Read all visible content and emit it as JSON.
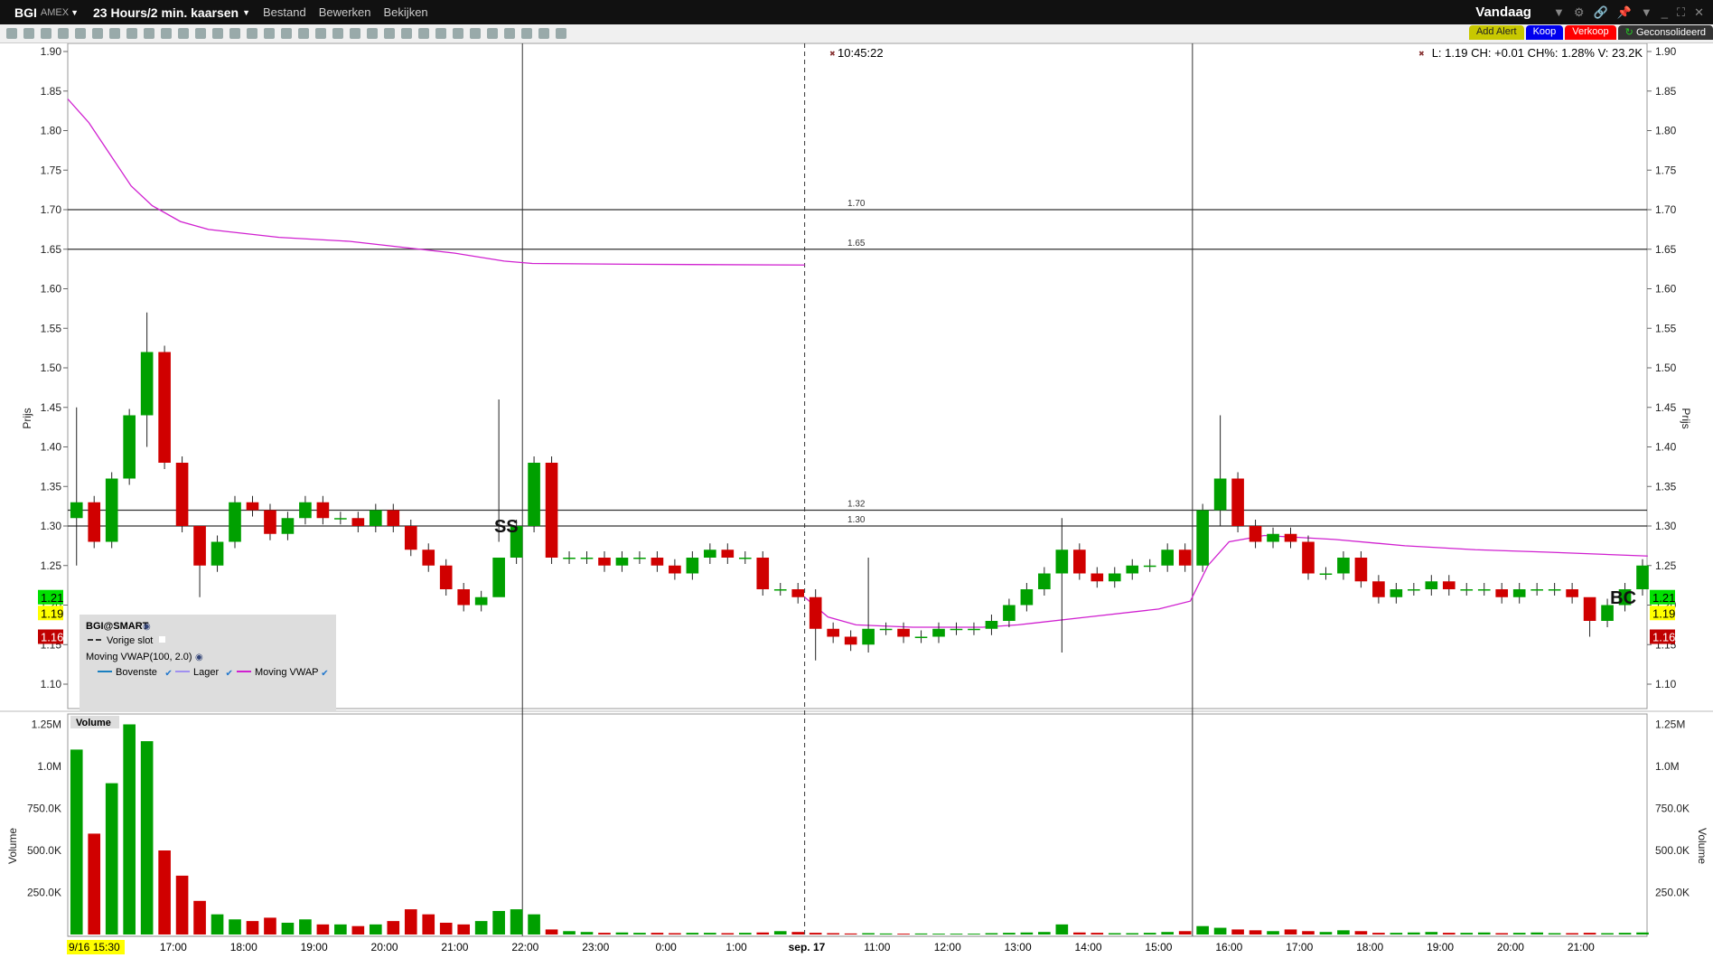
{
  "window": {
    "symbol": "BGI",
    "exchange": "AMEX",
    "period": "23 Hours/2 min. kaarsen",
    "menus": [
      "Bestand",
      "Bewerken",
      "Bekijken"
    ],
    "range": "Vandaag"
  },
  "buttons": {
    "add_alert": "Add Alert",
    "buy": "Koop",
    "sell": "Verkoop",
    "consolidated": "Geconsolideerd"
  },
  "status": "L: 1.19 CH: +0.01 CH%: 1.28% V: 23.2K",
  "crosshair_time": "10:45:22",
  "legend": {
    "title": "BGI@SMART",
    "prev_close": "Vorige slot",
    "indicator": "Moving VWAP(100, 2.0)",
    "items": [
      "Bovenste",
      "Lager",
      "Moving VWAP"
    ]
  },
  "colors": {
    "up": "#00a000",
    "down": "#d00000",
    "vwap": "#d020d0",
    "upper": "#1a7fc0",
    "lower": "#a090f0"
  },
  "chart_data": {
    "type": "candlestick",
    "price_axis": {
      "label": "Prijs",
      "ylim": [
        1.1,
        1.9
      ],
      "ticks": [
        "1.90",
        "1.85",
        "1.80",
        "1.75",
        "1.70",
        "1.65",
        "1.60",
        "1.55",
        "1.50",
        "1.45",
        "1.40",
        "1.35",
        "1.30",
        "1.25",
        "1.20",
        "1.15",
        "1.10"
      ]
    },
    "volume_axis": {
      "label": "Volume",
      "title": "Volume",
      "ylim_k": [
        0,
        1300
      ],
      "ticks": [
        "1.25M",
        "1.0M",
        "750.0K",
        "500.0K",
        "250.0K"
      ]
    },
    "x_axis": {
      "unit": "session hours from 9/16 15:30",
      "xlim": [
        0,
        22.45
      ],
      "ticks": [
        {
          "x": 0,
          "label": "9/16 15:30"
        },
        {
          "x": 1.5,
          "label": "17:00"
        },
        {
          "x": 2.5,
          "label": "18:00"
        },
        {
          "x": 3.5,
          "label": "19:00"
        },
        {
          "x": 4.5,
          "label": "20:00"
        },
        {
          "x": 5.5,
          "label": "21:00"
        },
        {
          "x": 6.5,
          "label": "22:00"
        },
        {
          "x": 7.5,
          "label": "23:00"
        },
        {
          "x": 8.5,
          "label": "0:00"
        },
        {
          "x": 9.5,
          "label": "1:00"
        },
        {
          "x": 10.5,
          "label": "sep. 17"
        },
        {
          "x": 11.5,
          "label": "11:00"
        },
        {
          "x": 12.5,
          "label": "12:00"
        },
        {
          "x": 13.5,
          "label": "13:00"
        },
        {
          "x": 14.5,
          "label": "14:00"
        },
        {
          "x": 15.5,
          "label": "15:00"
        },
        {
          "x": 16.5,
          "label": "16:00"
        },
        {
          "x": 17.5,
          "label": "17:00"
        },
        {
          "x": 18.5,
          "label": "18:00"
        },
        {
          "x": 19.5,
          "label": "19:00"
        },
        {
          "x": 20.5,
          "label": "20:00"
        },
        {
          "x": 21.5,
          "label": "21:00"
        }
      ]
    },
    "candle_step_hours": 0.25,
    "closes": [
      1.33,
      1.28,
      1.36,
      1.44,
      1.52,
      1.38,
      1.3,
      1.25,
      1.28,
      1.33,
      1.32,
      1.29,
      1.31,
      1.33,
      1.31,
      1.31,
      1.3,
      1.32,
      1.3,
      1.27,
      1.25,
      1.22,
      1.2,
      1.21,
      1.26,
      1.3,
      1.38,
      1.26,
      1.26,
      1.26,
      1.25,
      1.26,
      1.26,
      1.25,
      1.24,
      1.26,
      1.27,
      1.26,
      1.26,
      1.22,
      1.22,
      1.21,
      1.17,
      1.16,
      1.15,
      1.17,
      1.17,
      1.16,
      1.16,
      1.17,
      1.17,
      1.17,
      1.18,
      1.2,
      1.22,
      1.24,
      1.27,
      1.24,
      1.23,
      1.24,
      1.25,
      1.25,
      1.27,
      1.25,
      1.32,
      1.36,
      1.3,
      1.28,
      1.29,
      1.28,
      1.24,
      1.24,
      1.26,
      1.23,
      1.21,
      1.22,
      1.22,
      1.23,
      1.22,
      1.22,
      1.22,
      1.21,
      1.22,
      1.22,
      1.22,
      1.21,
      1.18,
      1.2,
      1.22,
      1.25
    ],
    "wicks": [
      {
        "i": 0,
        "high": 1.45,
        "low": 1.25
      },
      {
        "i": 4,
        "high": 1.57,
        "low": 1.4
      },
      {
        "i": 7,
        "high": 1.28,
        "low": 1.21
      },
      {
        "i": 24,
        "high": 1.46,
        "low": 1.28
      },
      {
        "i": 42,
        "high": 1.22,
        "low": 1.13
      },
      {
        "i": 45,
        "high": 1.26,
        "low": 1.14
      },
      {
        "i": 56,
        "high": 1.31,
        "low": 1.14
      },
      {
        "i": 65,
        "high": 1.44,
        "low": 1.3
      },
      {
        "i": 86,
        "high": 1.2,
        "low": 1.16
      }
    ],
    "volumes_k": [
      1100,
      600,
      900,
      1250,
      1150,
      500,
      350,
      200,
      120,
      90,
      80,
      100,
      70,
      90,
      60,
      60,
      50,
      60,
      80,
      150,
      120,
      70,
      60,
      80,
      140,
      150,
      120,
      30,
      20,
      15,
      10,
      12,
      10,
      10,
      8,
      10,
      10,
      8,
      10,
      12,
      20,
      15,
      10,
      8,
      6,
      8,
      6,
      5,
      6,
      5,
      5,
      5,
      8,
      10,
      12,
      15,
      60,
      12,
      10,
      8,
      8,
      10,
      15,
      20,
      50,
      40,
      30,
      25,
      20,
      30,
      20,
      15,
      25,
      20,
      10,
      10,
      12,
      15,
      10,
      10,
      12,
      8,
      10,
      12,
      8,
      8,
      10,
      8,
      10,
      12
    ],
    "vwap_day1": [
      [
        0,
        1.84
      ],
      [
        0.3,
        1.81
      ],
      [
        0.6,
        1.77
      ],
      [
        0.9,
        1.73
      ],
      [
        1.2,
        1.705
      ],
      [
        1.6,
        1.685
      ],
      [
        2.0,
        1.675
      ],
      [
        3.0,
        1.665
      ],
      [
        4.0,
        1.66
      ],
      [
        4.8,
        1.652
      ],
      [
        5.5,
        1.645
      ],
      [
        6.2,
        1.635
      ],
      [
        6.6,
        1.632
      ],
      [
        8,
        1.631
      ],
      [
        10.47,
        1.63
      ]
    ],
    "vwap_day2": [
      [
        10.47,
        1.21
      ],
      [
        10.8,
        1.185
      ],
      [
        11.2,
        1.175
      ],
      [
        12,
        1.172
      ],
      [
        13,
        1.172
      ],
      [
        13.5,
        1.175
      ],
      [
        14.5,
        1.185
      ],
      [
        15.5,
        1.195
      ],
      [
        15.95,
        1.205
      ],
      [
        16.2,
        1.25
      ],
      [
        16.5,
        1.28
      ],
      [
        17,
        1.288
      ],
      [
        18,
        1.283
      ],
      [
        19,
        1.275
      ],
      [
        20,
        1.27
      ],
      [
        21,
        1.267
      ],
      [
        22.45,
        1.262
      ]
    ],
    "hlines": [
      {
        "price": 1.7,
        "label": "1.70"
      },
      {
        "price": 1.65,
        "label": "1.65"
      },
      {
        "price": 1.32,
        "label": "1.32"
      },
      {
        "price": 1.3,
        "label": "1.30"
      }
    ],
    "vlines": [
      {
        "x": 6.46,
        "style": "solid"
      },
      {
        "x": 10.47,
        "style": "dashed"
      },
      {
        "x": 15.98,
        "style": "solid"
      }
    ],
    "annotations": [
      {
        "text": "SS",
        "x": 6.23,
        "price": 1.3
      },
      {
        "text": "BC",
        "x": 22.1,
        "price": 1.21
      }
    ],
    "price_tags": [
      {
        "label": "1.21",
        "bg": "#00e000"
      },
      {
        "label": "1.19",
        "bg": "#ffff00"
      },
      {
        "label": "1.16",
        "bg": "#c00000"
      }
    ]
  }
}
